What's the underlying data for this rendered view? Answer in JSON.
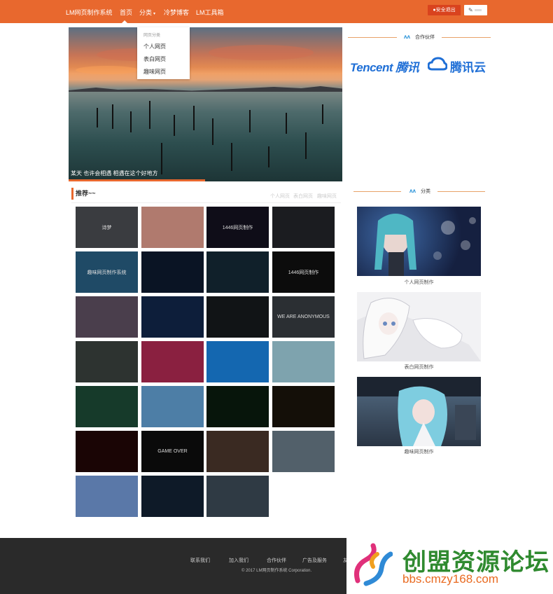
{
  "header": {
    "brand": "LM网页制作系统",
    "nav": [
      "首页",
      "分类",
      "冷梦博客",
      "LM工具箱"
    ],
    "caret": "▾",
    "logout_label": "安全退出",
    "edit_icon": "✎"
  },
  "dropdown": {
    "header": "网页分类",
    "items": [
      "个人网页",
      "表白网页",
      "趣味网页"
    ]
  },
  "banner": {
    "caption": "某天 也许会相遇 相遇在这个好地方"
  },
  "partners": {
    "title": "合作伙伴",
    "tencent": "Tencent 腾讯",
    "tencent_cloud": "腾讯云"
  },
  "recommend": {
    "title": "推荐~~",
    "tabs": [
      "个人网页",
      "表白网页",
      "趣味网页"
    ],
    "thumbs": [
      {
        "label": "诗梦",
        "bg": "#3a3c40"
      },
      {
        "label": "",
        "bg": "#b07a6e"
      },
      {
        "label": "1446网页制作",
        "bg": "#0f0d18"
      },
      {
        "label": "",
        "bg": "#1b1c20"
      },
      {
        "label": "趣味网页制作系统",
        "bg": "#1f4a66"
      },
      {
        "label": "",
        "bg": "#0a1424"
      },
      {
        "label": "",
        "bg": "#10202a"
      },
      {
        "label": "1446网页制作",
        "bg": "#0c0c0c"
      },
      {
        "label": "",
        "bg": "#4a3e4c"
      },
      {
        "label": "",
        "bg": "#0d1e3a"
      },
      {
        "label": "",
        "bg": "#111416"
      },
      {
        "label": "WE ARE ANONYMOUS",
        "bg": "#2b2f33"
      },
      {
        "label": "",
        "bg": "#2d3330"
      },
      {
        "label": "",
        "bg": "#8a2040"
      },
      {
        "label": "",
        "bg": "#1467b0"
      },
      {
        "label": "",
        "bg": "#7ea3ae"
      },
      {
        "label": "",
        "bg": "#163a2a"
      },
      {
        "label": "",
        "bg": "#4d7ea6"
      },
      {
        "label": "",
        "bg": "#07150b"
      },
      {
        "label": "",
        "bg": "#140f08"
      },
      {
        "label": "",
        "bg": "#1a0505"
      },
      {
        "label": "GAME OVER",
        "bg": "#0a0a0a"
      },
      {
        "label": "",
        "bg": "#3a2a22"
      },
      {
        "label": "",
        "bg": "#52606a"
      },
      {
        "label": "",
        "bg": "#5a78a8"
      },
      {
        "label": "",
        "bg": "#0e1a28"
      },
      {
        "label": "",
        "bg": "#2f3a44"
      }
    ]
  },
  "category": {
    "title": "分类",
    "cards": [
      {
        "label": "个人网页制作",
        "bg": "#1d2a48"
      },
      {
        "label": "表白网页制作",
        "bg": "#eceef2"
      },
      {
        "label": "趣味网页制作",
        "bg": "#3c5066"
      }
    ]
  },
  "footer": {
    "links": [
      "联系我们",
      "加入我们",
      "合作伙伴",
      "广告及服务",
      "友"
    ],
    "copyright": "© 2017 LM网页制作系统 Corporation."
  },
  "watermark": {
    "title": "创盟资源论坛",
    "url": "bbs.cmzy168.com"
  }
}
